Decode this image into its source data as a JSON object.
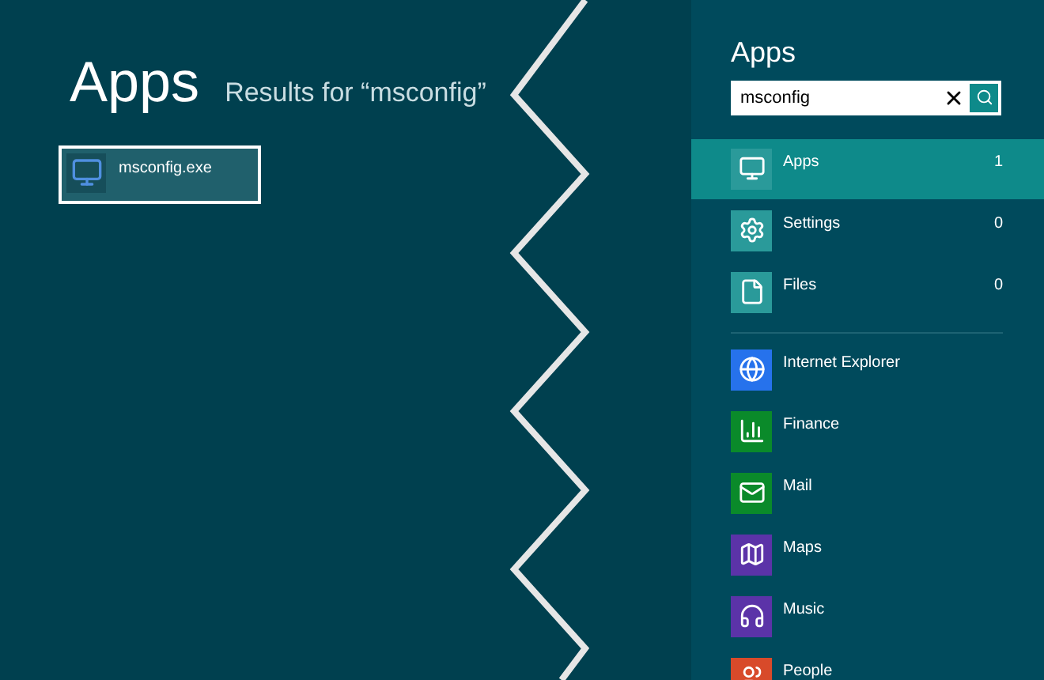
{
  "results": {
    "heading": "Apps",
    "subtitle": "Results for “msconfig”",
    "items": [
      {
        "label": "msconfig.exe",
        "selected": true
      }
    ]
  },
  "search_pane": {
    "title": "Apps",
    "search": {
      "value": "msconfig"
    },
    "categories": [
      {
        "label": "Apps",
        "count": "1",
        "selected": true
      },
      {
        "label": "Settings",
        "count": "0",
        "selected": false
      },
      {
        "label": "Files",
        "count": "0",
        "selected": false
      }
    ],
    "apps": [
      {
        "label": "Internet Explorer",
        "color": "#2672ec"
      },
      {
        "label": "Finance",
        "color": "#0a8a2a"
      },
      {
        "label": "Mail",
        "color": "#0a8a2a"
      },
      {
        "label": "Maps",
        "color": "#5b33a8"
      },
      {
        "label": "Music",
        "color": "#5b33a8"
      },
      {
        "label": "People",
        "color": "#d84a2a"
      }
    ]
  }
}
